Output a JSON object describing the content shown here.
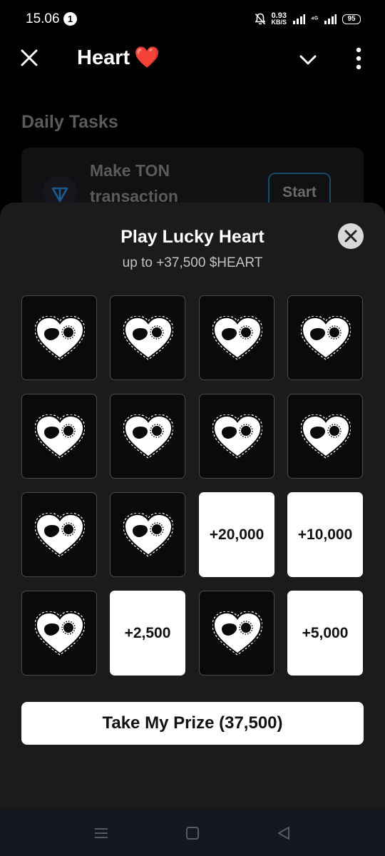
{
  "status_bar": {
    "time": "15.06",
    "notification_count": "1",
    "net_speed": "0.93",
    "net_unit": "KB/S",
    "signal": "⁴ᴳ",
    "battery": "95"
  },
  "header": {
    "title": "Heart",
    "emoji": "❤️"
  },
  "background": {
    "section_title": "Daily Tasks",
    "task_label": "Make TON transaction",
    "start_label": "Start"
  },
  "sheet": {
    "title": "Play Lucky Heart",
    "subtitle": "up to +37,500 $HEART",
    "tiles": [
      {
        "state": "hidden"
      },
      {
        "state": "hidden"
      },
      {
        "state": "hidden"
      },
      {
        "state": "hidden"
      },
      {
        "state": "hidden"
      },
      {
        "state": "hidden"
      },
      {
        "state": "hidden"
      },
      {
        "state": "hidden"
      },
      {
        "state": "hidden"
      },
      {
        "state": "hidden"
      },
      {
        "state": "revealed",
        "value": "+20,000"
      },
      {
        "state": "revealed",
        "value": "+10,000"
      },
      {
        "state": "hidden"
      },
      {
        "state": "revealed",
        "value": "+2,500"
      },
      {
        "state": "hidden"
      },
      {
        "state": "revealed",
        "value": "+5,000"
      }
    ],
    "prize_button": "Take My Prize (37,500)"
  },
  "nav": {
    "icons": [
      "recents-icon",
      "home-icon",
      "back-icon"
    ]
  }
}
